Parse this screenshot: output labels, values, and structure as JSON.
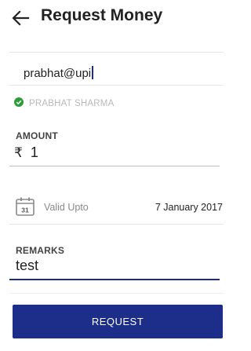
{
  "header": {
    "title": "Request Money",
    "back_icon": "arrow-left-icon"
  },
  "payee": {
    "vpa_value": "prabhat@upi",
    "verified_name": "PRABHAT SHARMA",
    "verified_icon": "check-circle-icon",
    "verified_color": "#2e9b3a"
  },
  "amount": {
    "label": "AMOUNT",
    "currency_symbol": "₹",
    "value": "1"
  },
  "validity": {
    "calendar_icon": "calendar-icon",
    "calendar_day": "31",
    "label": "Valid Upto",
    "date": "7 January 2017"
  },
  "remarks": {
    "label": "REMARKS",
    "value": "test"
  },
  "actions": {
    "request_label": "REQUEST"
  },
  "colors": {
    "primary": "#1d2d8a"
  }
}
